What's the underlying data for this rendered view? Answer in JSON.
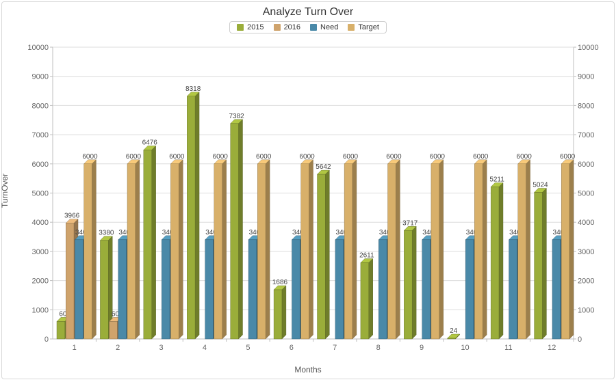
{
  "chart_data": {
    "type": "bar",
    "title": "Analyze Turn Over",
    "xlabel": "Months",
    "ylabel": "TurnOver",
    "ylim": [
      0,
      10000
    ],
    "ystep": 1000,
    "categories": [
      "1",
      "2",
      "3",
      "4",
      "5",
      "6",
      "7",
      "8",
      "9",
      "10",
      "11",
      "12"
    ],
    "series": [
      {
        "name": "2015",
        "color": "#9aad3a",
        "values": [
          600,
          3380,
          6476,
          8318,
          7382,
          1686,
          5642,
          2611,
          3717,
          24,
          5211,
          5024
        ]
      },
      {
        "name": "2016",
        "color": "#cfa36c",
        "values": [
          3966,
          600,
          null,
          null,
          null,
          null,
          null,
          null,
          null,
          null,
          null,
          null
        ]
      },
      {
        "name": "Need",
        "color": "#4a89a8",
        "values": [
          3400,
          3400,
          3400,
          3400,
          3400,
          3400,
          3400,
          3400,
          3400,
          3400,
          3400,
          3400
        ]
      },
      {
        "name": "Target",
        "color": "#d8b06a",
        "values": [
          6000,
          6000,
          6000,
          6000,
          6000,
          6000,
          6000,
          6000,
          6000,
          6000,
          6000,
          6000
        ]
      }
    ],
    "legend_position": "top",
    "grid": true,
    "show_labels_need": "340",
    "show_labels_s2015_1": "60",
    "show_labels_s2016_2": "60"
  }
}
